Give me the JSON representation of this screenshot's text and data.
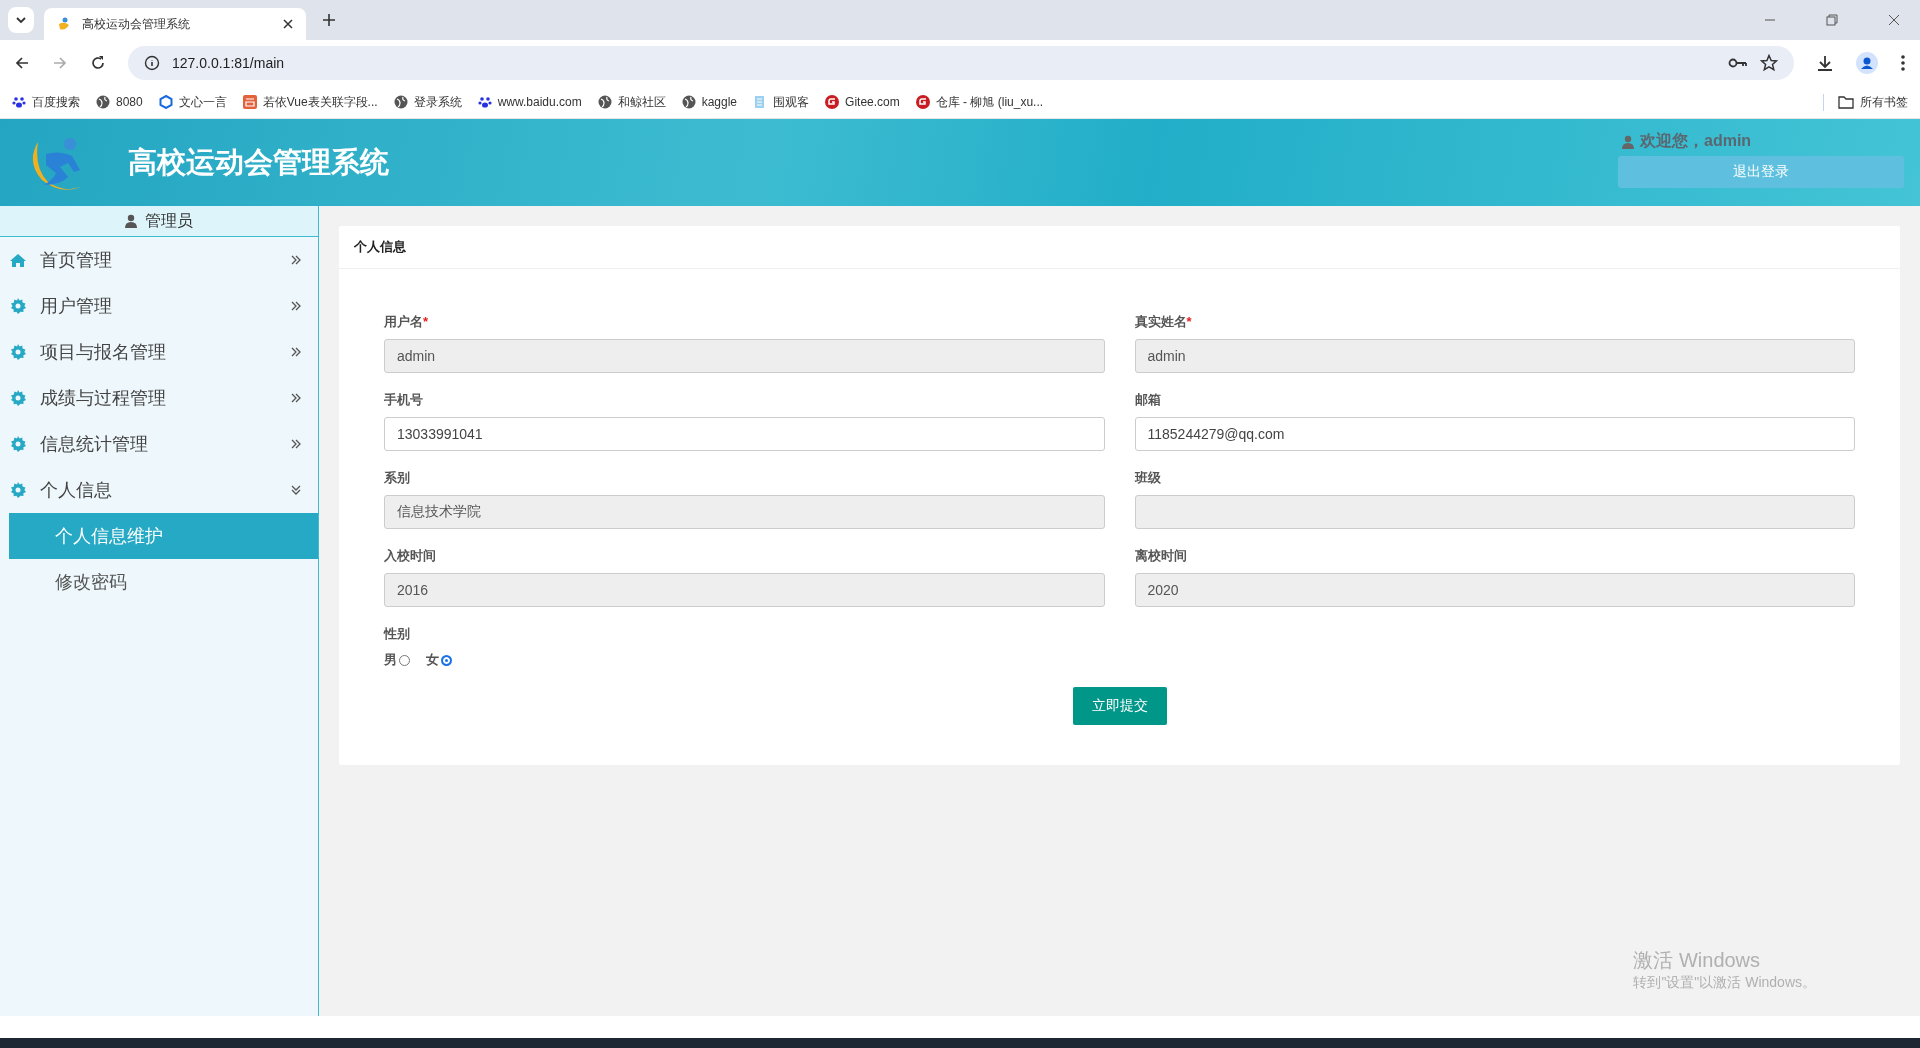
{
  "browser": {
    "tab_title": "高校运动会管理系统",
    "url": "127.0.0.1:81/main",
    "bookmarks": [
      {
        "label": "百度搜索",
        "kind": "paw"
      },
      {
        "label": "8080",
        "kind": "globe"
      },
      {
        "label": "文心一言",
        "kind": "cube"
      },
      {
        "label": "若依Vue表关联字段...",
        "kind": "jian"
      },
      {
        "label": "登录系统",
        "kind": "globe"
      },
      {
        "label": "www.baidu.com",
        "kind": "paw"
      },
      {
        "label": "和鲸社区",
        "kind": "globe"
      },
      {
        "label": "kaggle",
        "kind": "globe"
      },
      {
        "label": "围观客",
        "kind": "square"
      },
      {
        "label": "Gitee.com",
        "kind": "gitee"
      },
      {
        "label": "仓库 - 柳旭 (liu_xu...",
        "kind": "gitee"
      }
    ],
    "all_bookmarks": "所有书签"
  },
  "header": {
    "title": "高校运动会管理系统",
    "welcome": "欢迎您，admin",
    "logout": "退出登录"
  },
  "sidebar": {
    "role": "管理员",
    "items": [
      {
        "label": "首页管理",
        "kind": "home",
        "expanded": false
      },
      {
        "label": "用户管理",
        "kind": "gear",
        "expanded": false
      },
      {
        "label": "项目与报名管理",
        "kind": "gear",
        "expanded": false
      },
      {
        "label": "成绩与过程管理",
        "kind": "gear",
        "expanded": false
      },
      {
        "label": "信息统计管理",
        "kind": "gear",
        "expanded": false
      },
      {
        "label": "个人信息",
        "kind": "gear",
        "expanded": true,
        "children": [
          {
            "label": "个人信息维护",
            "selected": true
          },
          {
            "label": "修改密码",
            "selected": false
          }
        ]
      }
    ]
  },
  "panel": {
    "title": "个人信息",
    "fields": [
      {
        "label": "用户名",
        "required_mark": "*",
        "value": "admin",
        "disabled": true
      },
      {
        "label": "真实姓名",
        "required_mark": "*",
        "value": "admin",
        "disabled": true
      },
      {
        "label": "手机号",
        "value": "13033991041",
        "disabled": false
      },
      {
        "label": "邮箱",
        "value": "1185244279@qq.com",
        "disabled": false
      },
      {
        "label": "系别",
        "value": "信息技术学院",
        "disabled": true
      },
      {
        "label": "班级",
        "disabled": true
      },
      {
        "label": "入校时间",
        "value": "2016",
        "disabled": true
      },
      {
        "label": "离校时间",
        "value": "2020",
        "disabled": true
      }
    ],
    "gender": {
      "label": "性别",
      "options": [
        {
          "label": "男",
          "selected": false
        },
        {
          "label": "女",
          "selected": true
        }
      ]
    },
    "submit": "立即提交"
  },
  "activation": {
    "title": "激活 Windows",
    "hint": "转到\"设置\"以激活 Windows。"
  }
}
